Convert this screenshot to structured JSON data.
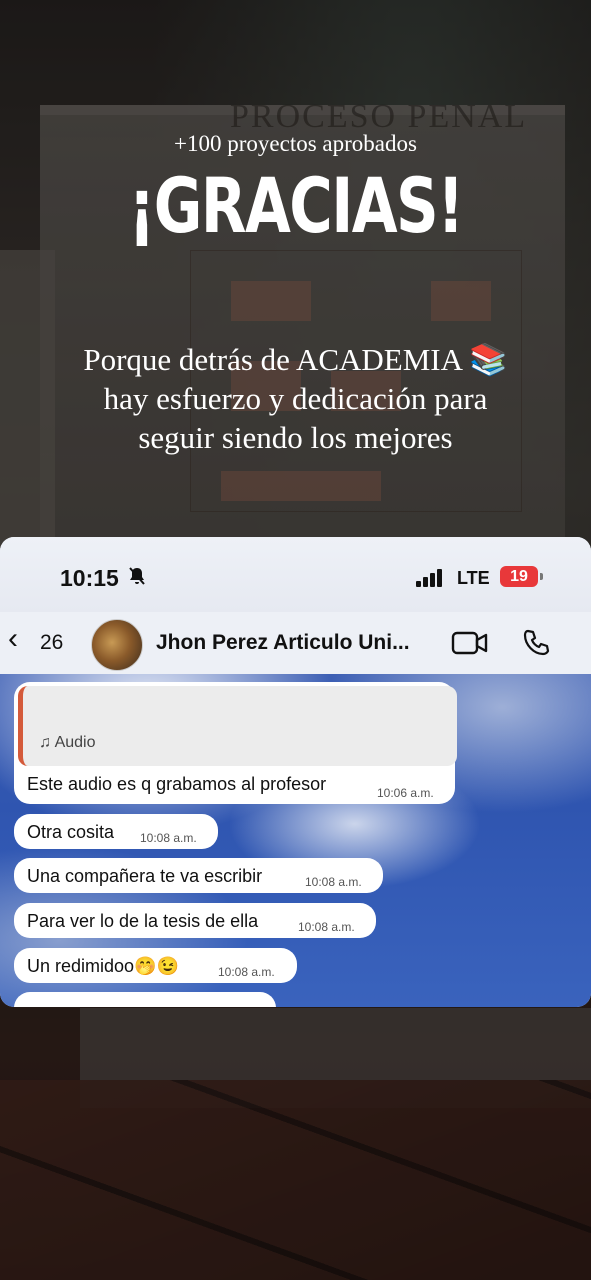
{
  "overlay": {
    "kicker": "+100 proyectos aprobados",
    "headline": "¡GRACIAS!",
    "subtext_line1": "Porque detrás de ACADEMIA 📚",
    "subtext_line2": "hay esfuerzo y dedicación para",
    "subtext_line3": "seguir siendo los mejores"
  },
  "background": {
    "board_title": "PROCESO PENAL"
  },
  "status_bar": {
    "time": "10:15",
    "network": "LTE",
    "battery": "19",
    "battery_color": "#e8383a"
  },
  "chat_header": {
    "back_count": "26",
    "contact_name": "Jhon Perez Articulo Uni..."
  },
  "messages": [
    {
      "reply_label": "Audio",
      "text": "Este audio es q grabamos al profesor",
      "time": "10:06 a.m."
    },
    {
      "text": "Otra cosita",
      "time": "10:08 a.m."
    },
    {
      "text": "Una compañera te va escribir",
      "time": "10:08 a.m."
    },
    {
      "text": "Para ver lo de la tesis de ella",
      "time": "10:08 a.m."
    },
    {
      "text": "Un redimidoo🤭😉",
      "time": "10:08 a.m."
    }
  ]
}
